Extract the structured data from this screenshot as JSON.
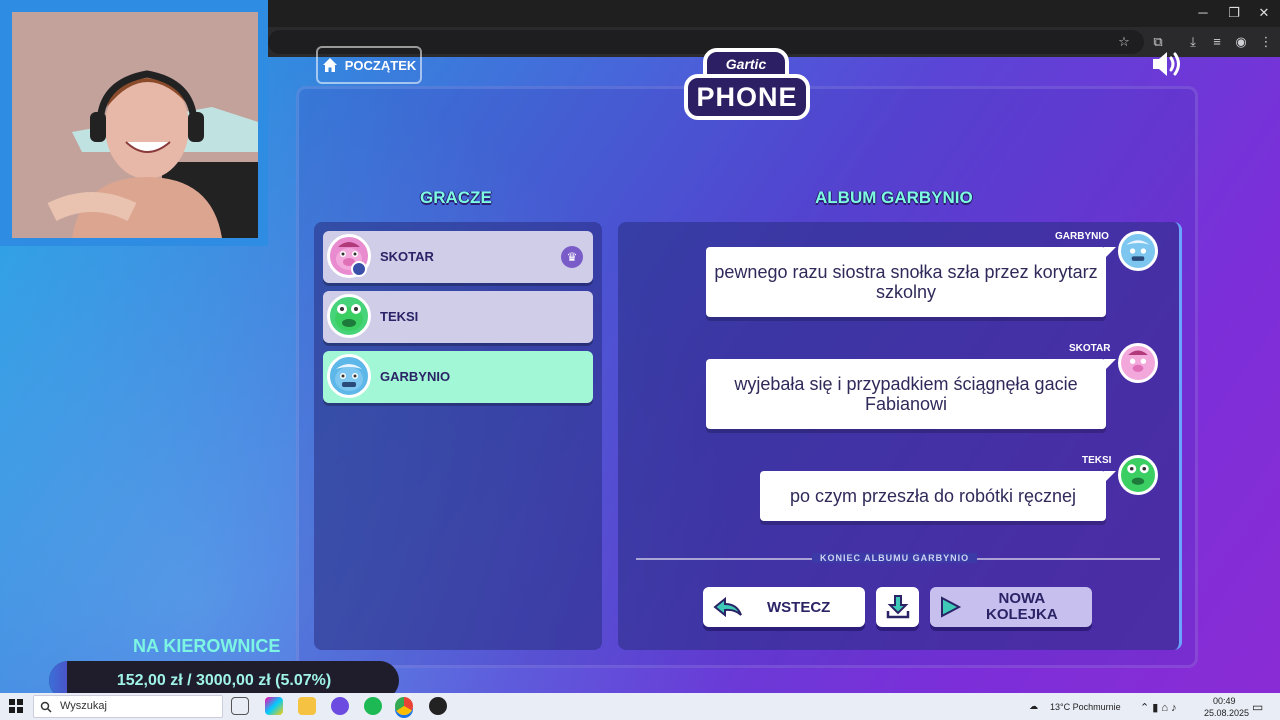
{
  "browser": {
    "window_controls": {
      "minimize": "─",
      "restore": "❐",
      "close": "✕"
    },
    "toolbar_icons": [
      "star-icon",
      "extensions-icon",
      "download-icon",
      "media-icon",
      "profile-icon",
      "menu-icon"
    ]
  },
  "game": {
    "home_label": "POCZĄTEK",
    "logo_top": "Gartic",
    "logo_bottom": "PHONE",
    "players_title": "GRACZE",
    "album_title": "ALBUM GARBYNIO",
    "players": [
      {
        "name": "SKOTAR",
        "host": true,
        "color": "#e88ccf"
      },
      {
        "name": "TEKSI",
        "host": false,
        "color": "#46d37a"
      },
      {
        "name": "GARBYNIO",
        "host": false,
        "color": "#5db7e8",
        "active": true
      }
    ],
    "album": [
      {
        "author": "GARBYNIO",
        "text": "pewnego razu siostra snołka szła przez korytarz szkolny"
      },
      {
        "author": "SKOTAR",
        "text": "wyjebała się i przypadkiem ściągnęła gacie Fabianowi"
      },
      {
        "author": "TEKSI",
        "text": "po czym przeszła do robótki ręcznej"
      }
    ],
    "end_label": "KONIEC ALBUMU GARBYNIO",
    "back_label": "WSTECZ",
    "next_label_1": "NOWA",
    "next_label_2": "KOLEJKA"
  },
  "overlay": {
    "donation_title": "NA KIEROWNICE",
    "donation_text": "152,00 zł / 3000,00 zł (5.07%)",
    "donation_fraction": 0.0507
  },
  "taskbar": {
    "search_placeholder": "Wyszukaj",
    "weather": "13°C  Pochmurnie",
    "time": "00:49",
    "date": "25.08.2025"
  }
}
